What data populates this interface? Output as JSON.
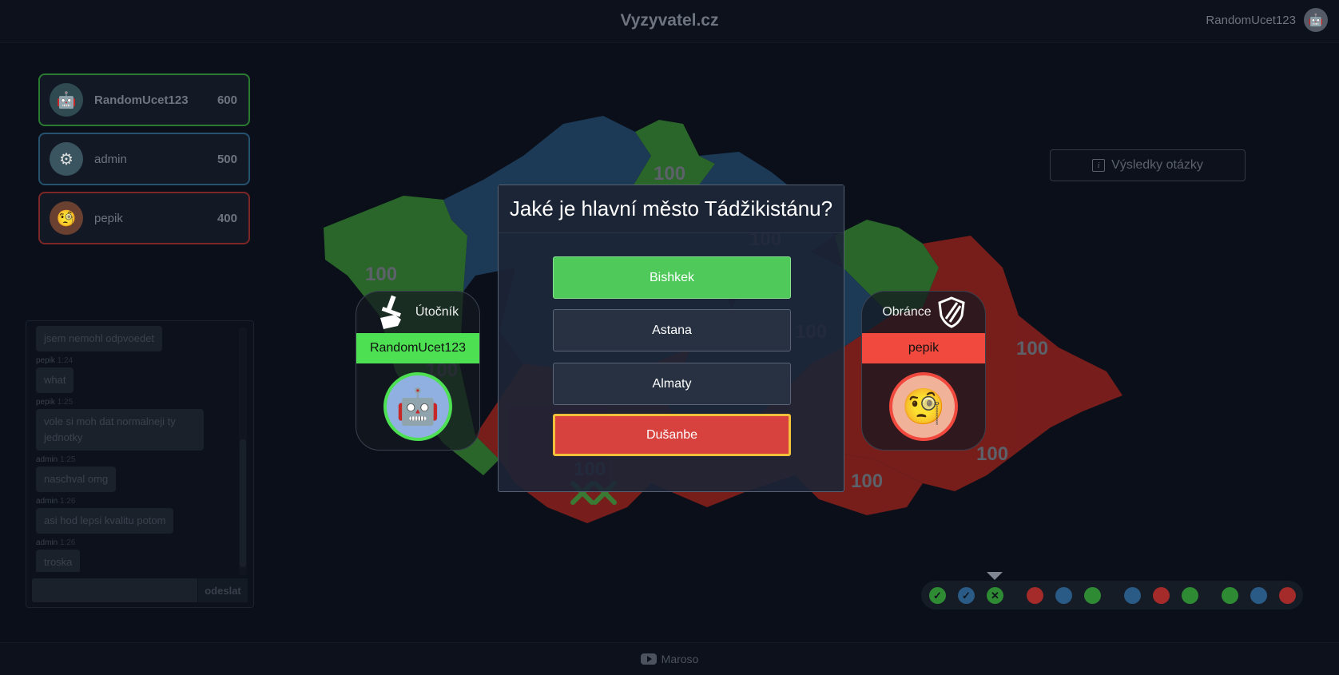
{
  "header": {
    "title": "Vyzyvatel.cz",
    "username": "RandomUcet123"
  },
  "players": [
    {
      "name": "RandomUcet123",
      "score": "600",
      "color": "#2b7a31",
      "avatar": "robot-icon"
    },
    {
      "name": "admin",
      "score": "500",
      "color": "#25526e",
      "avatar": "gear-face-icon"
    },
    {
      "name": "pepik",
      "score": "400",
      "color": "#7c2626",
      "avatar": "monocle-face-icon"
    }
  ],
  "chat": {
    "messages": [
      {
        "author": "",
        "time": "",
        "text": "jsem nemohl odpvoedet"
      },
      {
        "author": "pepik",
        "time": "1:24",
        "text": "what"
      },
      {
        "author": "pepik",
        "time": "1:25",
        "text": "vole si moh dat normalneji ty jednotky"
      },
      {
        "author": "admin",
        "time": "1:25",
        "text": "naschval omg"
      },
      {
        "author": "admin",
        "time": "1:26",
        "text": "asi hod lepsi kvalitu potom"
      },
      {
        "author": "admin",
        "time": "1:26",
        "text": "troska"
      }
    ],
    "input_placeholder": "",
    "send_label": "odeslat"
  },
  "map": {
    "region_values": [
      "100",
      "100",
      "100",
      "100",
      "100",
      "100",
      "100",
      "100",
      "100",
      "100",
      "100"
    ],
    "colors": {
      "green": "#2c6b2a",
      "blue": "#1e3c5a",
      "red": "#7d1f1b"
    }
  },
  "results_button": {
    "label": "Výsledky otázky"
  },
  "attacker": {
    "role": "Útočník",
    "name": "RandomUcet123",
    "color": "#4ce052"
  },
  "defender": {
    "role": "Obránce",
    "name": "pepik",
    "color": "#f2493f"
  },
  "question": {
    "text": "Jaké je hlavní město Tádžikistánu?",
    "answers": [
      {
        "text": "Bishkek",
        "state": "correct"
      },
      {
        "text": "Astana",
        "state": "neutral"
      },
      {
        "text": "Almaty",
        "state": "neutral"
      },
      {
        "text": "Dušanbe",
        "state": "wrong-selected"
      }
    ]
  },
  "rounds": [
    {
      "color": "#2e8b34",
      "state": "done"
    },
    {
      "color": "#2a5b86",
      "state": "done"
    },
    {
      "color": "#2e8b34",
      "state": "current"
    },
    {
      "color": "#a52a2a",
      "state": "pending"
    },
    {
      "color": "#2a5b86",
      "state": "pending"
    },
    {
      "color": "#2e8b34",
      "state": "pending"
    },
    {
      "color": "#2a5b86",
      "state": "pending"
    },
    {
      "color": "#a52a2a",
      "state": "pending"
    },
    {
      "color": "#2e8b34",
      "state": "pending"
    },
    {
      "color": "#2e8b34",
      "state": "pending"
    },
    {
      "color": "#2a5b86",
      "state": "pending"
    },
    {
      "color": "#a52a2a",
      "state": "pending"
    }
  ],
  "footer": {
    "label": "Maroso"
  }
}
